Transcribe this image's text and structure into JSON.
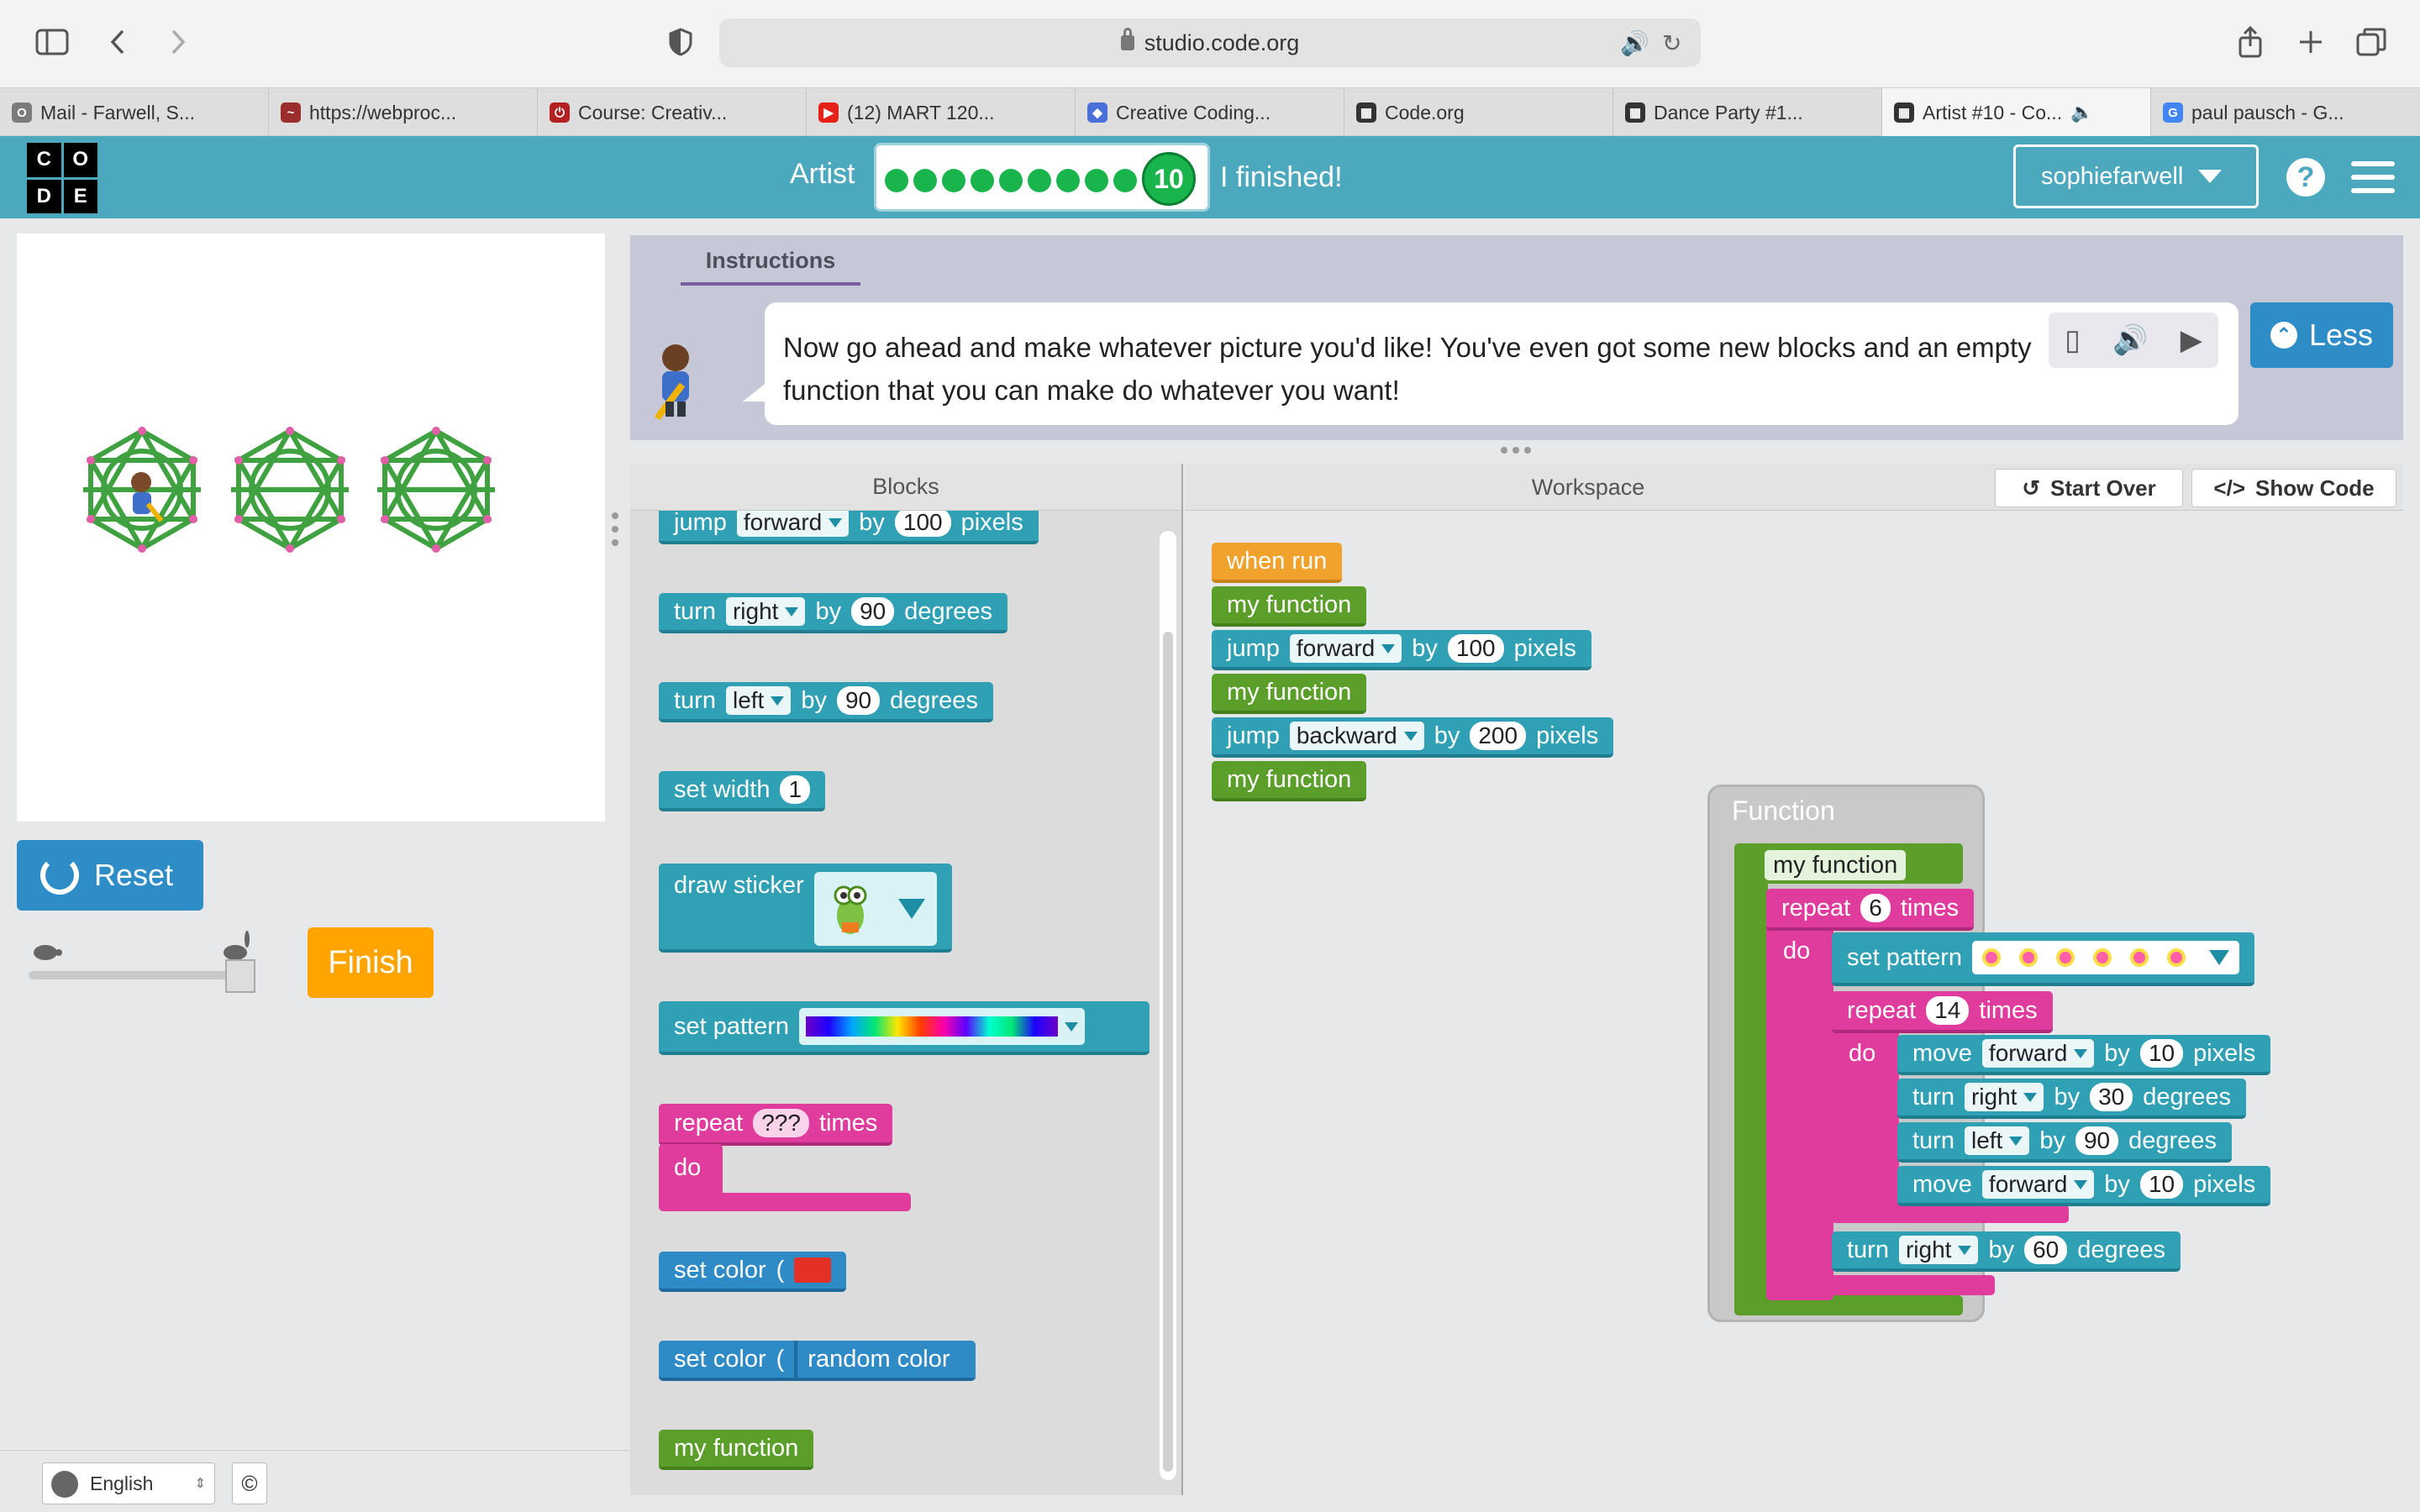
{
  "browser": {
    "url": "studio.code.org",
    "tabs": [
      {
        "label": "Mail - Farwell, S...",
        "fav_color": "#7b7b7b",
        "fav_text": "O"
      },
      {
        "label": "https://webproc...",
        "fav_color": "#9b2d2d",
        "fav_text": "~"
      },
      {
        "label": "Course: Creativ...",
        "fav_color": "#b22222",
        "fav_text": "⏻"
      },
      {
        "label": "(12) MART 120...",
        "fav_color": "#e62117",
        "fav_text": "▶"
      },
      {
        "label": "Creative Coding...",
        "fav_color": "#4a6fd8",
        "fav_text": "◆"
      },
      {
        "label": "Code.org",
        "fav_color": "#333333",
        "fav_text": "▦"
      },
      {
        "label": "Dance Party #1...",
        "fav_color": "#333333",
        "fav_text": "▦"
      },
      {
        "label": "Artist #10 - Co...",
        "fav_color": "#333333",
        "fav_text": "▦"
      },
      {
        "label": "paul pausch - G...",
        "fav_color": "#4285f4",
        "fav_text": "G"
      }
    ]
  },
  "header": {
    "logo_letters": [
      "C",
      "O",
      "D",
      "E"
    ],
    "puzzle_name": "Artist",
    "current_level": "10",
    "finished_label": "I finished!",
    "username": "sophiefarwell",
    "help_label": "?"
  },
  "stage": {
    "reset_label": "Reset",
    "finish_label": "Finish"
  },
  "instructions": {
    "tab_label": "Instructions",
    "text": "Now go ahead and make whatever picture you'd like! You've even got some new blocks and an empty function that you can make do whatever you want!",
    "less_label": "Less"
  },
  "toolbox": {
    "header": "Blocks",
    "blocks": {
      "jump": {
        "kw": "jump",
        "dir": "forward",
        "by": "by",
        "val": "100",
        "unit": "pixels"
      },
      "turn_right": {
        "kw": "turn",
        "dir": "right",
        "by": "by",
        "val": "90",
        "unit": "degrees"
      },
      "turn_left": {
        "kw": "turn",
        "dir": "left",
        "by": "by",
        "val": "90",
        "unit": "degrees"
      },
      "set_width": {
        "kw": "set width",
        "val": "1"
      },
      "draw_sticker": {
        "kw": "draw sticker"
      },
      "set_pattern": {
        "kw": "set pattern"
      },
      "repeat": {
        "kw": "repeat",
        "val": "???",
        "unit": "times",
        "do": "do"
      },
      "set_color": {
        "kw": "set color",
        "paren": "("
      },
      "set_color_random": {
        "kw": "set color",
        "paren": "(",
        "val": "random color"
      },
      "my_function": {
        "kw": "my function"
      }
    }
  },
  "workspace": {
    "header": "Workspace",
    "start_over_label": "Start Over",
    "show_code_label": "Show Code",
    "main": {
      "when_run": "when run",
      "call1": "my function",
      "jump1": {
        "kw": "jump",
        "dir": "forward",
        "by": "by",
        "val": "100",
        "unit": "pixels"
      },
      "call2": "my function",
      "jump2": {
        "kw": "jump",
        "dir": "backward",
        "by": "by",
        "val": "200",
        "unit": "pixels"
      },
      "call3": "my function"
    },
    "function": {
      "frame_title": "Function",
      "name": "my function",
      "repeat_outer": {
        "kw": "repeat",
        "val": "6",
        "unit": "times",
        "do": "do"
      },
      "set_pattern": {
        "kw": "set pattern"
      },
      "repeat_inner": {
        "kw": "repeat",
        "val": "14",
        "unit": "times",
        "do": "do"
      },
      "move1": {
        "kw": "move",
        "dir": "forward",
        "by": "by",
        "val": "10",
        "unit": "pixels"
      },
      "turn1": {
        "kw": "turn",
        "dir": "right",
        "by": "by",
        "val": "30",
        "unit": "degrees"
      },
      "turn2": {
        "kw": "turn",
        "dir": "left",
        "by": "by",
        "val": "90",
        "unit": "degrees"
      },
      "move2": {
        "kw": "move",
        "dir": "forward",
        "by": "by",
        "val": "10",
        "unit": "pixels"
      },
      "turn3": {
        "kw": "turn",
        "dir": "right",
        "by": "by",
        "val": "60",
        "unit": "degrees"
      }
    }
  },
  "footer": {
    "language": "English",
    "copyright": "©"
  }
}
